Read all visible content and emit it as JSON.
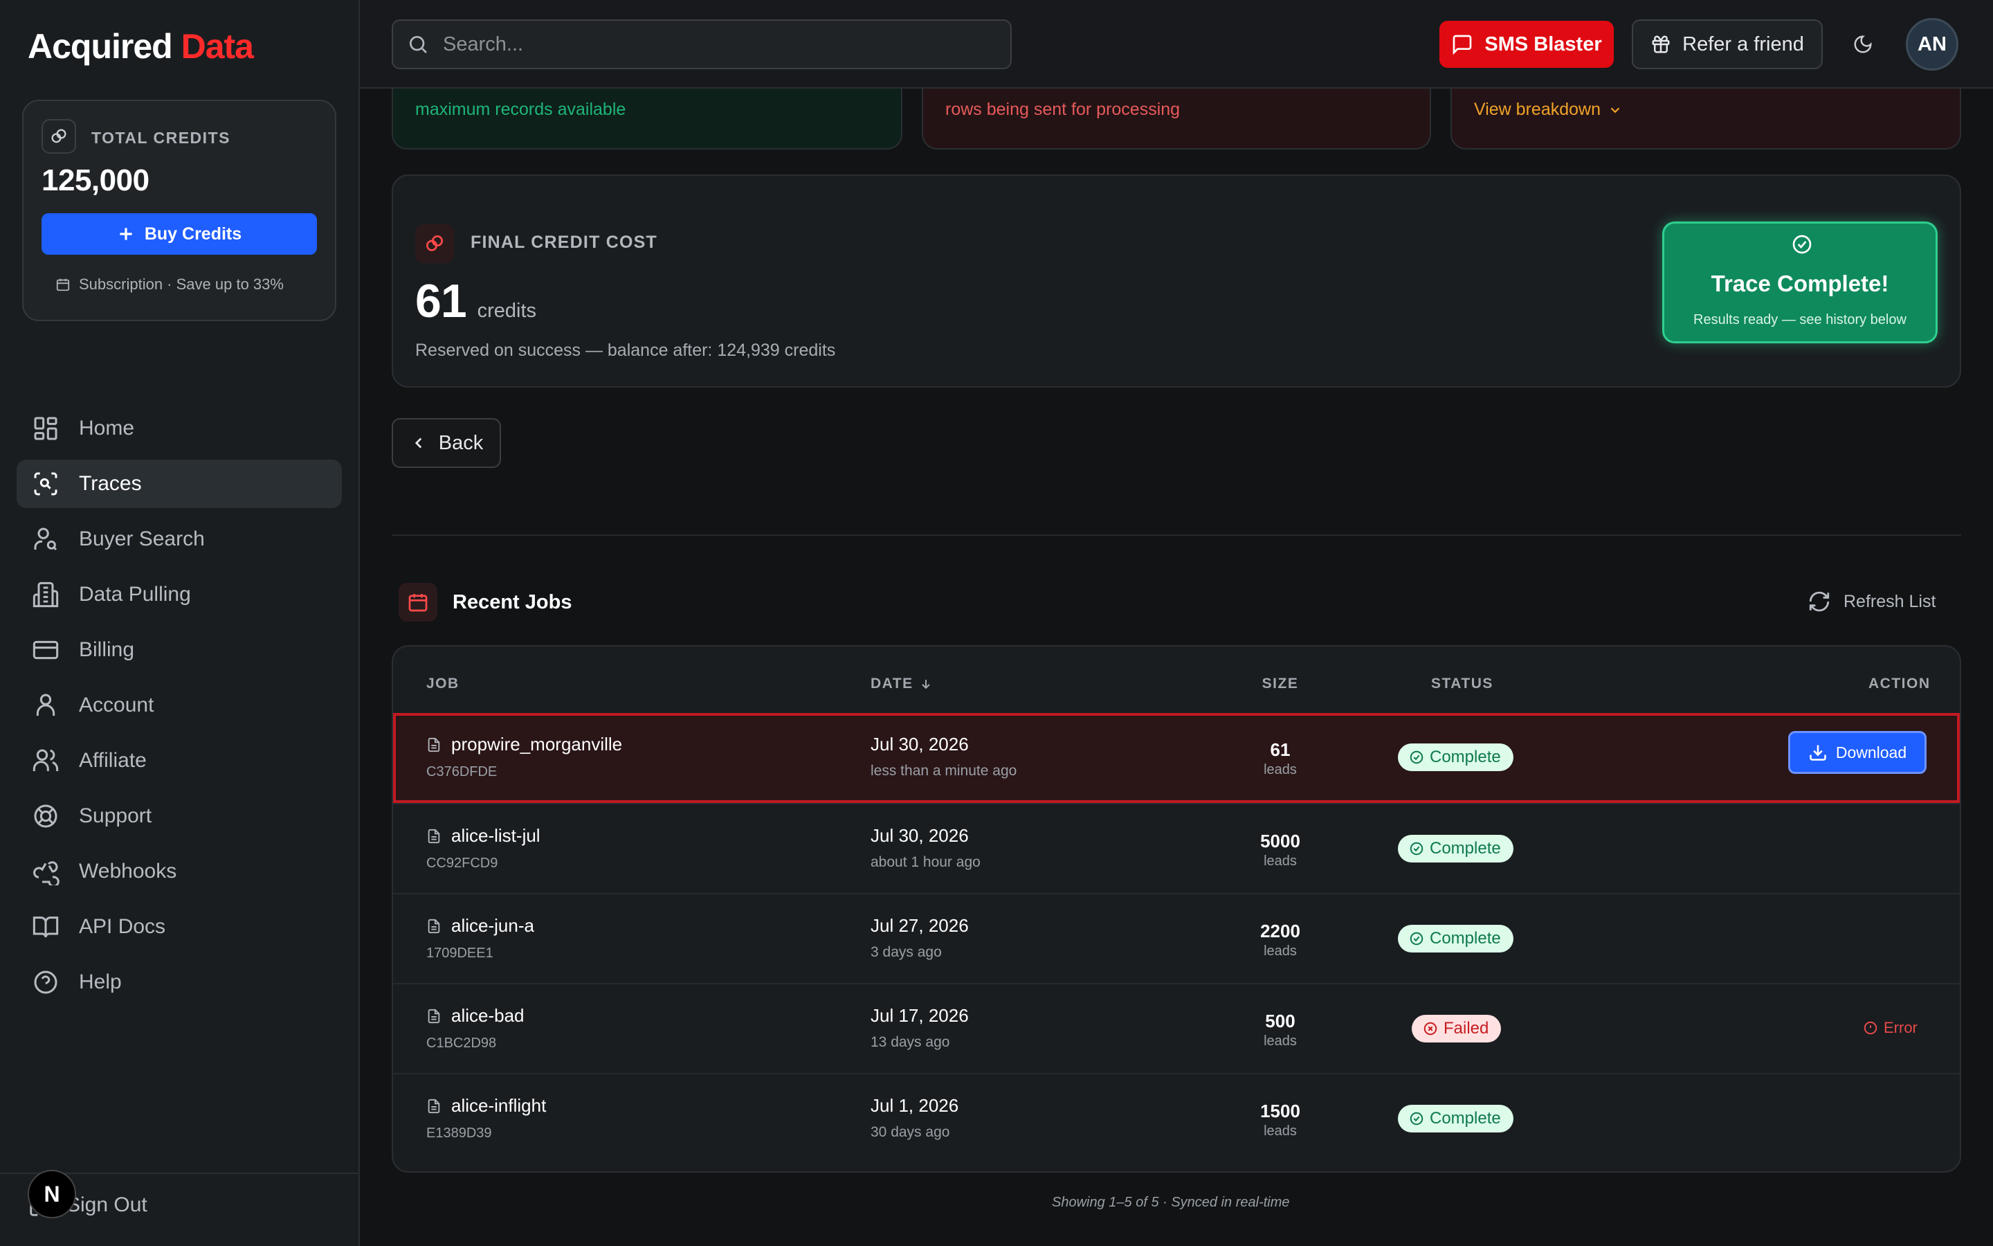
{
  "sidebar": {
    "brand_part1": "Acquired",
    "brand_part2": "Data",
    "credits_label": "TOTAL CREDITS",
    "credits_value": "125,000",
    "buy_label": "Buy Credits",
    "subscription_text": "Subscription · Save up to 33%",
    "nav": [
      {
        "label": "Home",
        "icon": "home-grid-icon"
      },
      {
        "label": "Traces",
        "icon": "scan-search-icon",
        "active": true
      },
      {
        "label": "Buyer Search",
        "icon": "user-search-icon"
      },
      {
        "label": "Data Pulling",
        "icon": "building-icon"
      },
      {
        "label": "Billing",
        "icon": "credit-card-icon"
      },
      {
        "label": "Account",
        "icon": "user-icon"
      },
      {
        "label": "Affiliate",
        "icon": "users-icon"
      },
      {
        "label": "Support",
        "icon": "lifebuoy-icon"
      },
      {
        "label": "Webhooks",
        "icon": "webhook-icon"
      },
      {
        "label": "API Docs",
        "icon": "book-icon"
      },
      {
        "label": "Help",
        "icon": "help-circle-icon"
      }
    ],
    "signout_label": "Sign Out",
    "badge_letter": "N"
  },
  "topbar": {
    "search_placeholder": "Search...",
    "sms_label": "SMS Blaster",
    "refer_label": "Refer a friend",
    "avatar_initials": "AN"
  },
  "stats": {
    "green_text": "maximum records available",
    "red_text": "rows being sent for processing",
    "amber_link": "View breakdown"
  },
  "cost": {
    "label": "FINAL CREDIT COST",
    "value": "61",
    "unit": "credits",
    "note": "Reserved on success — balance after: 124,939 credits",
    "trace_title": "Trace Complete!",
    "trace_subtitle": "Results ready — see history below"
  },
  "back_label": "Back",
  "jobs": {
    "title": "Recent Jobs",
    "refresh_label": "Refresh List",
    "columns": {
      "job": "JOB",
      "date": "DATE",
      "size": "SIZE",
      "status": "STATUS",
      "action": "ACTION"
    },
    "rows": [
      {
        "name": "propwire_morganville",
        "id": "C376DFDE",
        "date": "Jul 30, 2026",
        "relative": "less than a minute ago",
        "size": "61",
        "unit": "leads",
        "status": "Complete",
        "action": "Download"
      },
      {
        "name": "alice-list-jul",
        "id": "CC92FCD9",
        "date": "Jul 30, 2026",
        "relative": "about 1 hour ago",
        "size": "5000",
        "unit": "leads",
        "status": "Complete",
        "action": ""
      },
      {
        "name": "alice-jun-a",
        "id": "1709DEE1",
        "date": "Jul 27, 2026",
        "relative": "3 days ago",
        "size": "2200",
        "unit": "leads",
        "status": "Complete",
        "action": ""
      },
      {
        "name": "alice-bad",
        "id": "C1BC2D98",
        "date": "Jul 17, 2026",
        "relative": "13 days ago",
        "size": "500",
        "unit": "leads",
        "status": "Failed",
        "action": "Error"
      },
      {
        "name": "alice-inflight",
        "id": "E1389D39",
        "date": "Jul 1, 2026",
        "relative": "30 days ago",
        "size": "1500",
        "unit": "leads",
        "status": "Complete",
        "action": ""
      }
    ],
    "footer": "Showing 1–5 of 5 · Synced in real-time"
  },
  "colors": {
    "brand_red": "#ff2a2a",
    "primary_blue": "#1f5eff",
    "success_green": "#0f8a5c",
    "sms_red": "#e00a12"
  }
}
